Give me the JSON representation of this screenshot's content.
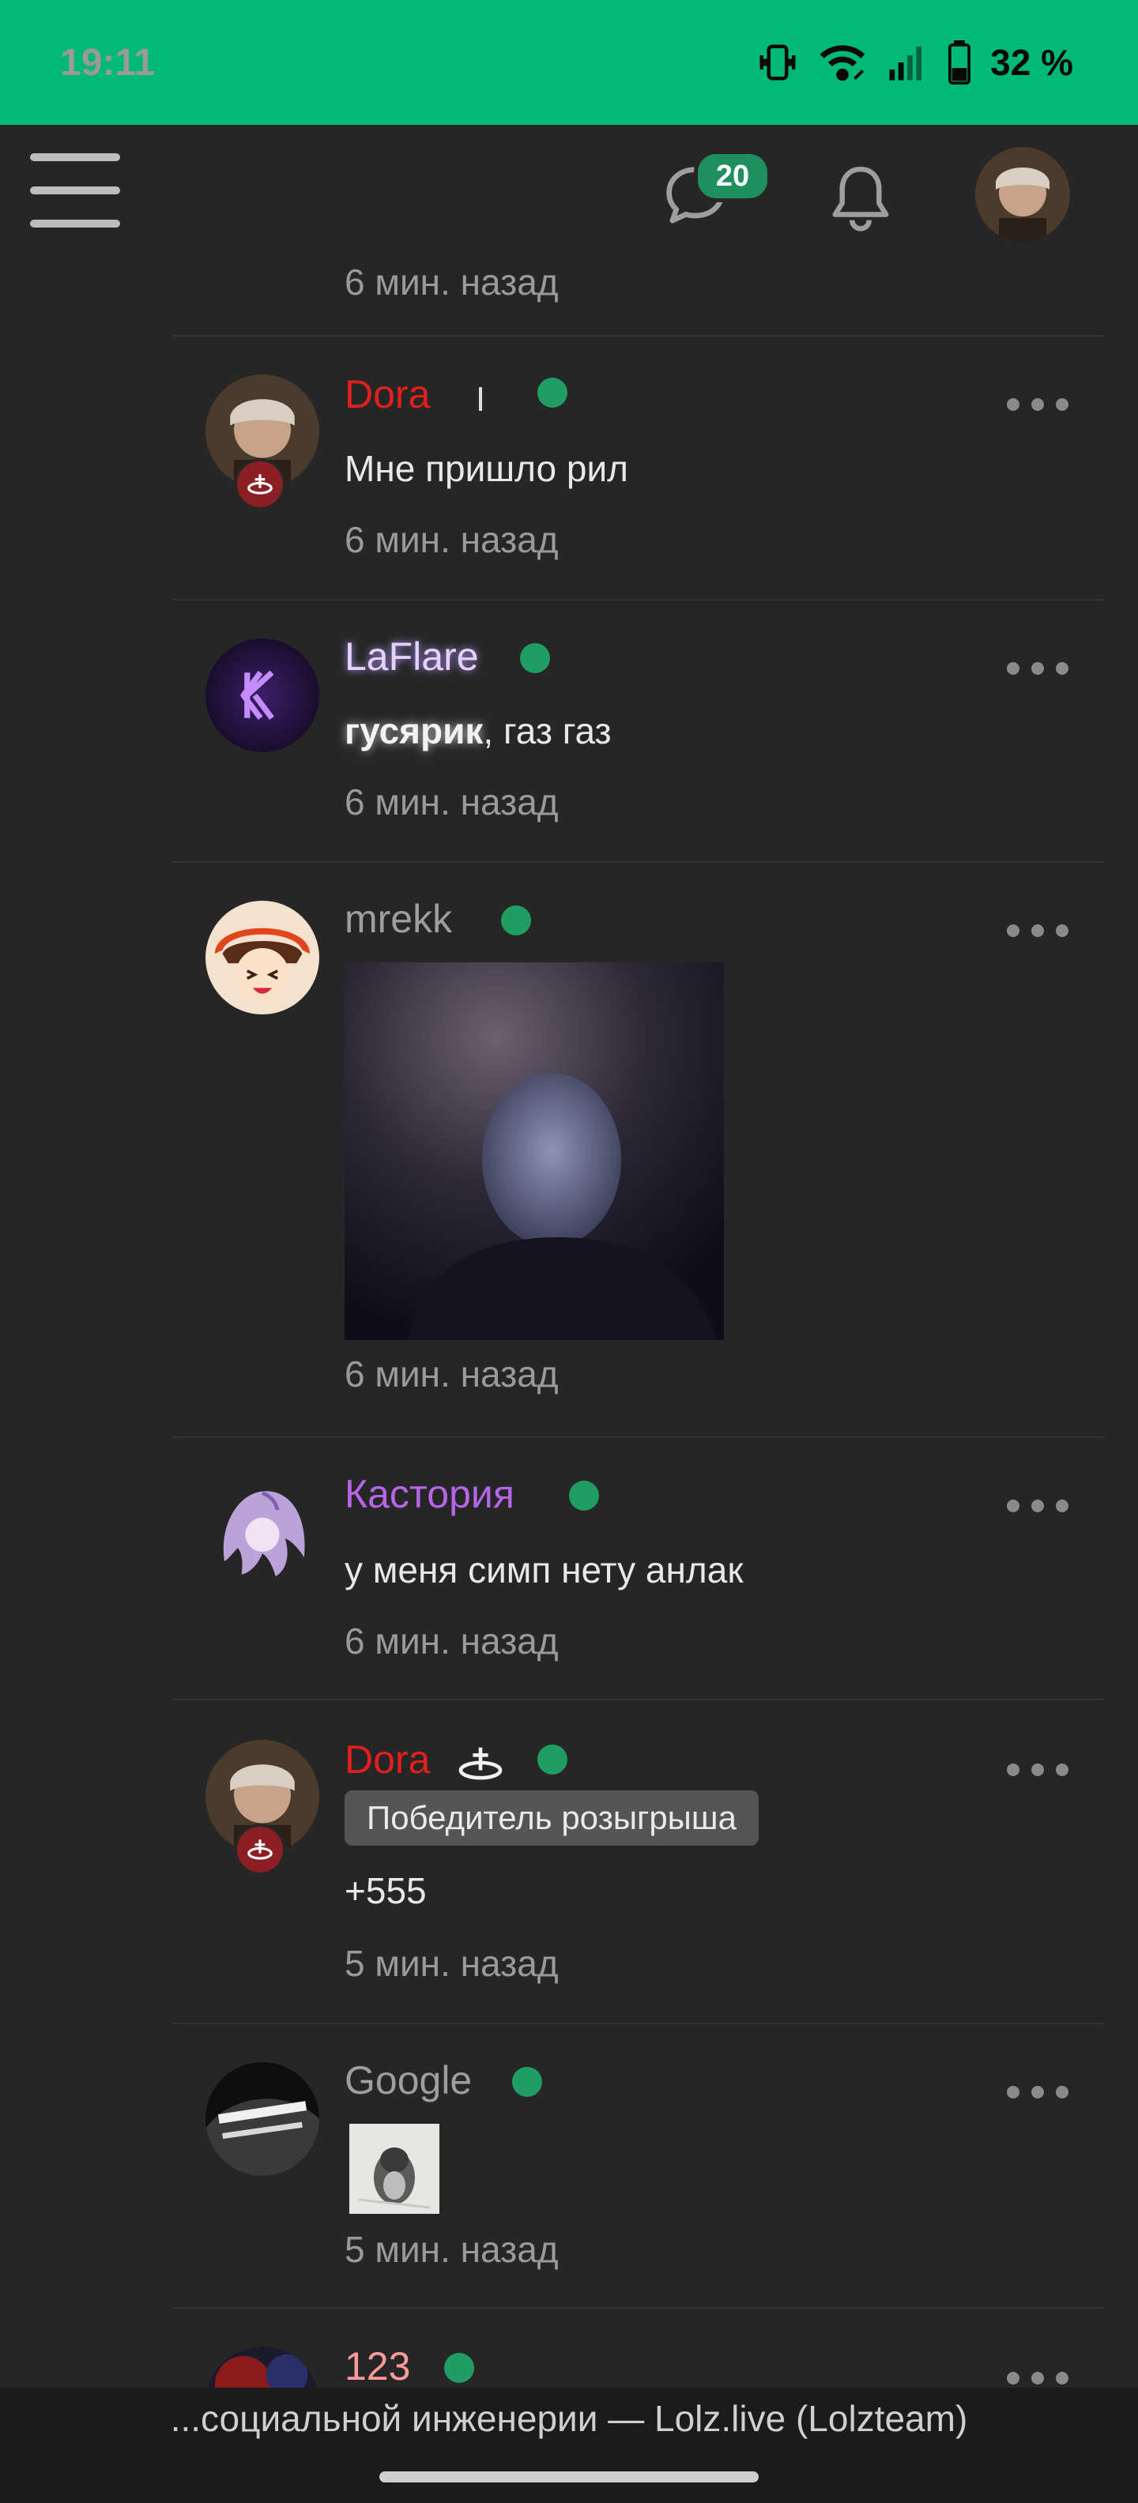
{
  "status_bar": {
    "time": "19:11",
    "battery": "32 %",
    "icons": [
      "vibrate-icon",
      "wifi-icon",
      "signal-icon",
      "battery-icon"
    ]
  },
  "header": {
    "menu_icon": "hamburger-icon",
    "messages_count": "20",
    "icons": [
      "chat-icon",
      "bell-icon",
      "avatar"
    ]
  },
  "feed": {
    "first_time": "6 мин. назад",
    "items": [
      {
        "username": "Dora",
        "username_color": "#e0201e",
        "message": "Мне пришло рил",
        "time": "6 мин. назад"
      },
      {
        "username": "LaFlare",
        "username_color": "#e7cfff",
        "message_bold": "гусярик",
        "message": ", газ газ",
        "time": "6 мин. назад"
      },
      {
        "username": "mrekk",
        "username_color": "#9e9e9e",
        "time": "6 мин. назад"
      },
      {
        "username": "Кастория",
        "username_color": "#b765e8",
        "message": "у меня симп нету анлак",
        "time": "6 мин. назад"
      },
      {
        "username": "Dora",
        "username_color": "#e0201e",
        "award": "Победитель розыгрыша",
        "message": "+555",
        "time": "5 мин. назад"
      },
      {
        "username": "Google",
        "username_color": "#9e9e9e",
        "time": "5 мин. назад"
      },
      {
        "username": "123",
        "username_color": "#ff9a9a"
      }
    ]
  },
  "footer": {
    "url_text": "...социальной инженерии — Lolz.live (Lolzteam)"
  },
  "colors": {
    "accent_green": "#00b976",
    "online_dot": "#1f9e63",
    "background": "#262626"
  }
}
